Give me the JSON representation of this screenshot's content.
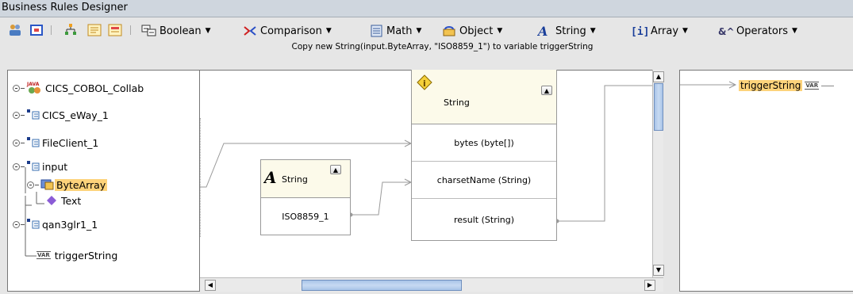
{
  "window": {
    "title": "Business Rules Designer"
  },
  "toolbar": {
    "menus": [
      {
        "label": "Boolean",
        "icon": "boolean-icon"
      },
      {
        "label": "Comparison",
        "icon": "comparison-icon"
      },
      {
        "label": "Math",
        "icon": "math-icon"
      },
      {
        "label": "Object",
        "icon": "object-icon"
      },
      {
        "label": "String",
        "icon": "string-icon"
      },
      {
        "label": "Array",
        "icon": "array-icon"
      },
      {
        "label": "Operators",
        "icon": "operators-icon"
      }
    ]
  },
  "status": {
    "text": "Copy new String(input.ByteArray, \"ISO8859_1\") to variable triggerString"
  },
  "tree": {
    "items": [
      {
        "label": "CICS_COBOL_Collab",
        "icon": "java-collab-icon",
        "badge": "JAVA"
      },
      {
        "label": "CICS_eWay_1",
        "icon": "otd-icon"
      },
      {
        "label": "FileClient_1",
        "icon": "otd-icon"
      },
      {
        "label": "input",
        "icon": "otd-icon"
      },
      {
        "label": "ByteArray",
        "icon": "bytearray-icon"
      },
      {
        "label": "Text",
        "icon": "field-diamond-icon"
      },
      {
        "label": "qan3glr1_1",
        "icon": "otd-icon"
      },
      {
        "label": "triggerString",
        "icon": "variable-icon",
        "badge": "VAR"
      }
    ]
  },
  "canvas": {
    "literal_node": {
      "title": "String",
      "value": "ISO8859_1"
    },
    "method_node": {
      "title": "String",
      "inputs": [
        "bytes (byte[])",
        "charsetName (String)"
      ],
      "output": "result (String)"
    }
  },
  "right_panel": {
    "variable": {
      "label": "triggerString",
      "badge": "VAR"
    }
  },
  "colors": {
    "selection": "#fdd37b",
    "node_header": "#fcfaea",
    "scroll_thumb": "#a8c4e8"
  }
}
